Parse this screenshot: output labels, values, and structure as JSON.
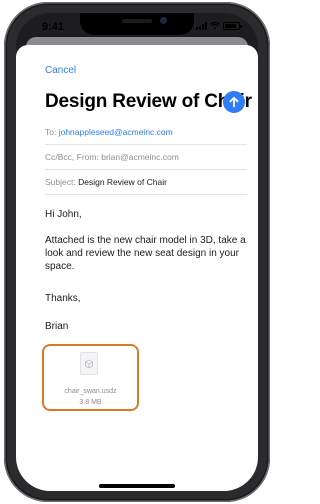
{
  "status": {
    "time": "9:41"
  },
  "compose": {
    "cancel_label": "Cancel",
    "title": "Design Review of Chair",
    "to_label": "To:",
    "to_value": "johnappleseed@acmeinc.com",
    "ccbcc_label": "Cc/Bcc, From:",
    "from_value": "brian@acmeinc.com",
    "subject_label": "Subject:",
    "subject_value": "Design Review of Chair"
  },
  "message": {
    "greeting": "Hi John,",
    "paragraph": "Attached is the new chair model in 3D, take a look and review the new seat design in your space.",
    "closing": "Thanks,",
    "signature": "Brian"
  },
  "attachment": {
    "filename": "chair_swan.usdz",
    "size": "3.8 MB",
    "highlight_color": "#d97a2b"
  },
  "colors": {
    "accent": "#2f7cf6"
  },
  "icons": [
    "send-arrow-icon",
    "ar-cube-icon",
    "signal-icon",
    "wifi-icon",
    "battery-icon"
  ]
}
